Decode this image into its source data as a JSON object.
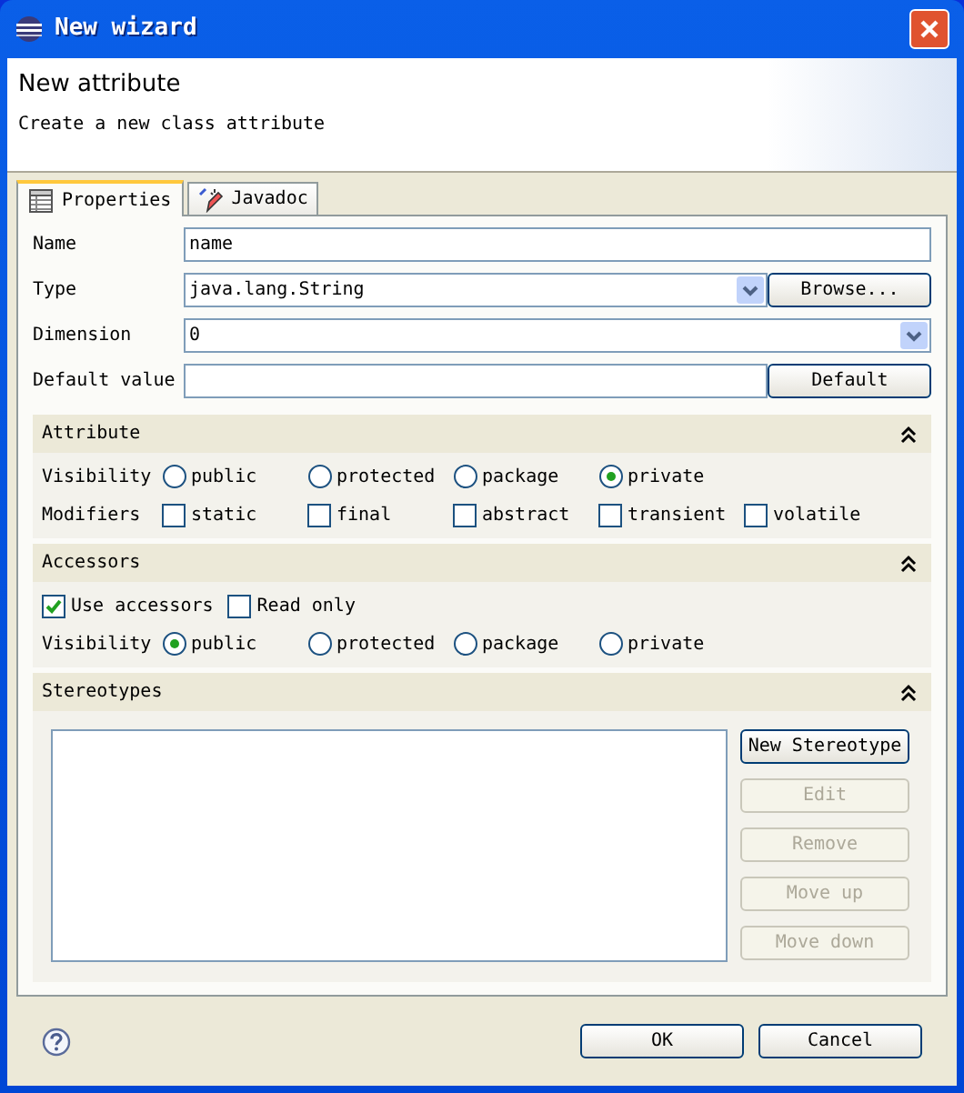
{
  "window": {
    "title": "New wizard"
  },
  "header": {
    "title": "New attribute",
    "description": "Create a new class attribute"
  },
  "tabs": [
    {
      "label": "Properties",
      "selected": true
    },
    {
      "label": "Javadoc",
      "selected": false
    }
  ],
  "fields": [
    {
      "label": "Name",
      "kind": "text",
      "value": "name"
    },
    {
      "label": "Type",
      "kind": "combo",
      "value": "java.lang.String",
      "button": "Browse..."
    },
    {
      "label": "Dimension",
      "kind": "combo",
      "value": "0"
    },
    {
      "label": "Default value",
      "kind": "text",
      "button": "Default"
    }
  ],
  "sections": [
    {
      "title": "Attribute",
      "expanded": true,
      "rows": [
        {
          "kind": "radio",
          "label": "Visibility",
          "options": [
            {
              "label": "public",
              "selected": false
            },
            {
              "label": "protected",
              "selected": false
            },
            {
              "label": "package",
              "selected": false
            },
            {
              "label": "private",
              "selected": true
            }
          ]
        },
        {
          "kind": "check",
          "label": "Modifiers",
          "options": [
            {
              "label": "static",
              "checked": false
            },
            {
              "label": "final",
              "checked": false
            },
            {
              "label": "abstract",
              "checked": false
            },
            {
              "label": "transient",
              "checked": false
            },
            {
              "label": "volatile",
              "checked": false
            }
          ]
        }
      ]
    },
    {
      "title": "Accessors",
      "expanded": true,
      "rows": [
        {
          "kind": "check",
          "options": [
            {
              "label": "Use accessors",
              "checked": true
            },
            {
              "label": "Read only",
              "checked": false
            }
          ]
        },
        {
          "kind": "radio",
          "label": "Visibility",
          "options": [
            {
              "label": "public",
              "selected": true
            },
            {
              "label": "protected",
              "selected": false
            },
            {
              "label": "package",
              "selected": false
            },
            {
              "label": "private",
              "selected": false
            }
          ]
        }
      ]
    },
    {
      "title": "Stereotypes",
      "expanded": true,
      "buttons": [
        {
          "label": "New Stereotype",
          "disabled": false
        },
        {
          "label": "Edit",
          "disabled": true
        },
        {
          "label": "Remove",
          "disabled": true
        },
        {
          "label": "Move up",
          "disabled": true
        },
        {
          "label": "Move down",
          "disabled": true
        }
      ]
    }
  ],
  "footer": {
    "buttons": [
      {
        "label": "OK"
      },
      {
        "label": "Cancel"
      }
    ]
  }
}
